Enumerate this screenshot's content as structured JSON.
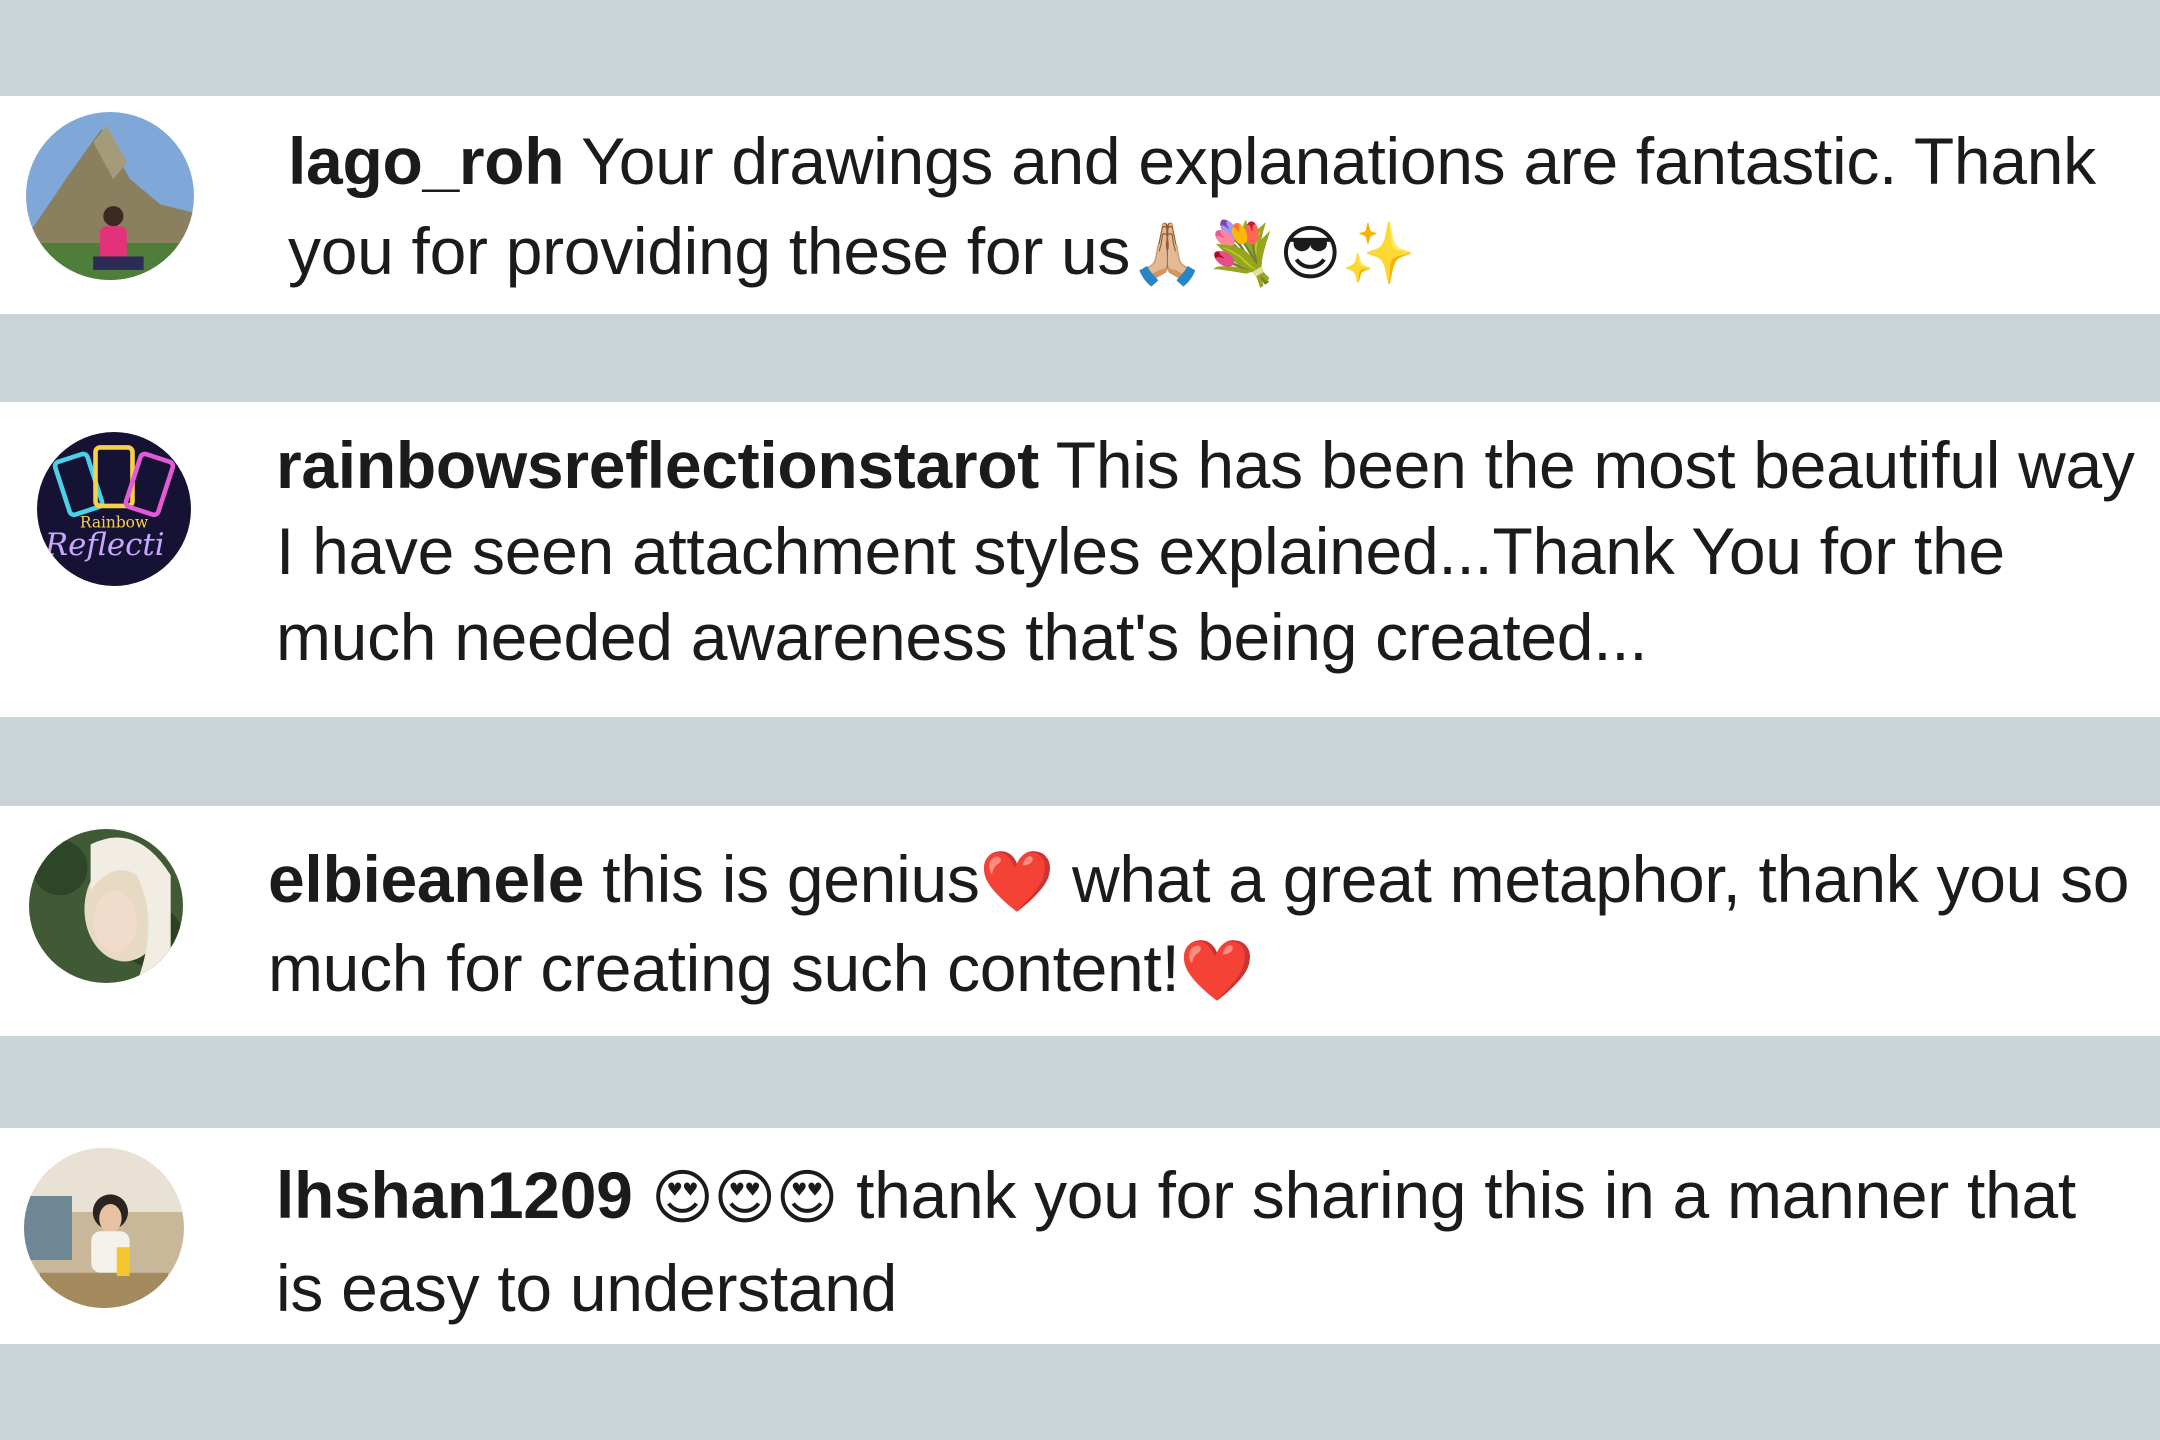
{
  "comments": [
    {
      "username": "lago_roh",
      "text": " Your drawings and explanations are fantastic. Thank you for providing these for us",
      "emojis": "🙏🏼💐😎✨",
      "avatar_icon": "mountain-photo-avatar"
    },
    {
      "username": "rainbowsreflectionstarot",
      "text": " This has been the most beautiful way I have seen attachment styles explained...Thank You for the much needed awareness that's being created...",
      "emojis": "",
      "avatar_icon": "tarot-logo-avatar",
      "avatar_logo_top": "Rainbow",
      "avatar_logo_bottom": "Reflecti"
    },
    {
      "username": "elbieanele",
      "text_part1": " this is genius",
      "emoji_mid": "❤️",
      "text_part2": " what a great metaphor, thank you so much for creating such content!",
      "emoji_end": "❤️",
      "avatar_icon": "portrait-photo-avatar"
    },
    {
      "username": "lhshan1209",
      "emojis_lead": " 😍😍😍",
      "text": " thank you for sharing this in a manner that is easy to understand",
      "avatar_icon": "person-photo-avatar"
    }
  ],
  "colors": {
    "background": "#c9d5d7",
    "card": "#ffffff",
    "text": "#1b1b1b"
  }
}
